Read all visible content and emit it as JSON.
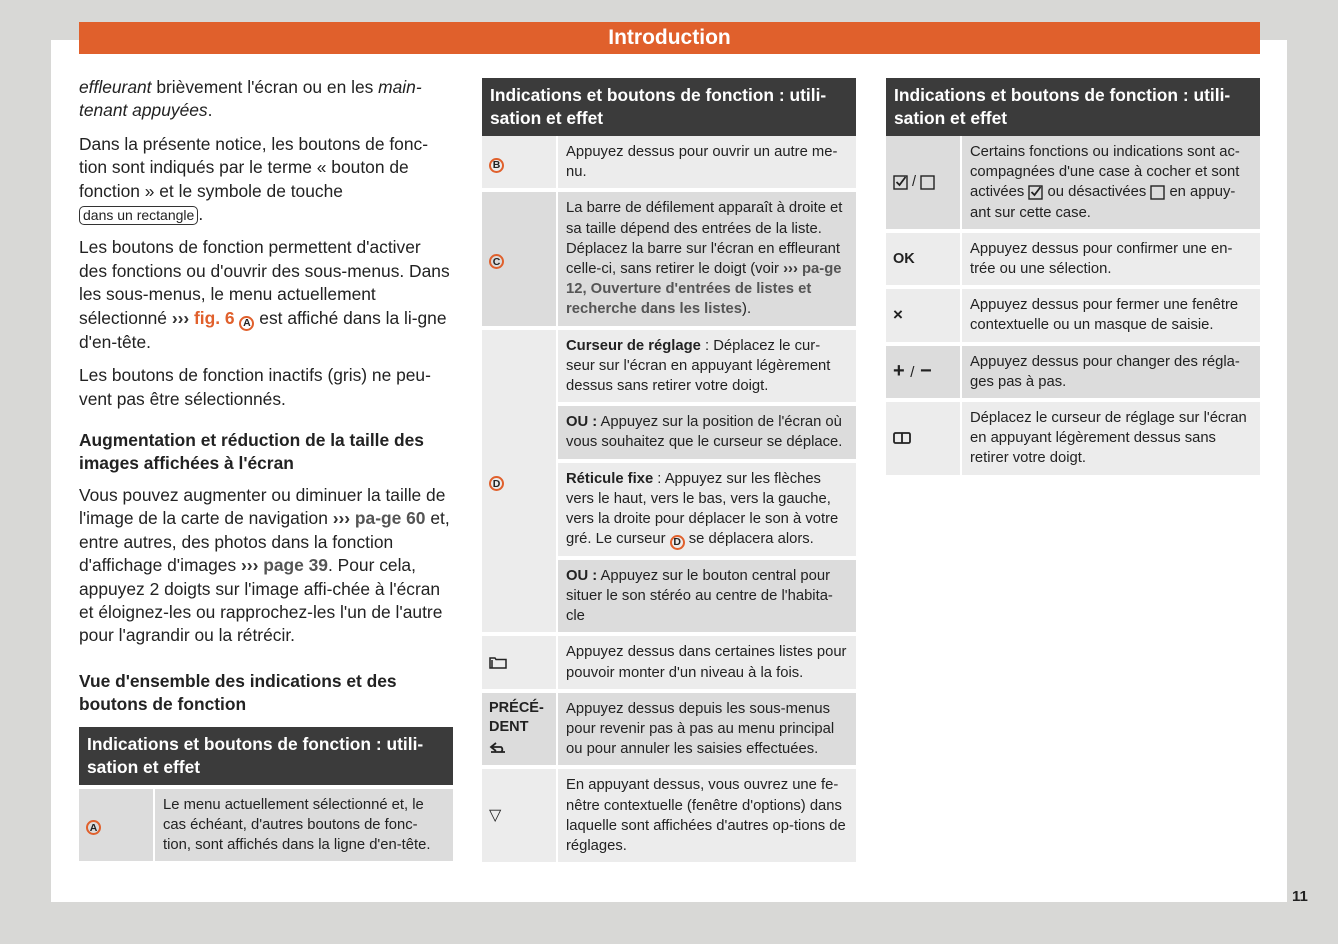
{
  "header": {
    "title": "Introduction",
    "accent_color": "#e0602c"
  },
  "page_number": "11",
  "column1": {
    "para1": {
      "i1": "effleurant",
      "t1": " brièvement l'écran ou en les ",
      "i2": "main-tenant appuyées",
      "t2": "."
    },
    "para2": {
      "text": "Dans la présente notice, les boutons de fonc-tion sont indiqués par le terme « bouton de fonction » et le symbole de touche ",
      "keybox": "dans un rectangle",
      "end": "."
    },
    "para3": {
      "t1": "Les boutons de fonction permettent d'activer des fonctions ou d'ouvrir des sous-menus. Dans les sous-menus, le menu actuellement sélectionné ",
      "chev": "›››",
      "ref": " fig. 6",
      "marker": "A",
      "t2": " est affiché dans la li-gne d'en-tête."
    },
    "para4": "Les boutons de fonction inactifs (gris) ne peu-vent pas être sélectionnés.",
    "heading1": "Augmentation et réduction de la taille des images affichées à l'écran",
    "para5": {
      "t1": "Vous pouvez augmenter ou diminuer la taille de l'image de la carte de navigation ",
      "chev1": "›››",
      "ref1": " pa-ge 60",
      "t2": " et, entre autres, des photos dans la fonction d'affichage d'images ",
      "chev2": "›››",
      "ref2": " page 39",
      "t3": ". Pour cela, appuyez 2 doigts sur l'image affi-chée à l'écran et éloignez-les ou rapprochez-les l'un de l'autre pour l'agrandir ou la rétrécir."
    },
    "heading2": "Vue d'ensemble des indications et des boutons de fonction",
    "table": {
      "title": "Indications et boutons de fonction : utili-sation et effet",
      "rows": [
        {
          "symbol": "A",
          "symbol_type": "circle-letter",
          "desc": "Le menu actuellement sélectionné et, le cas échéant, d'autres boutons de fonc-tion, sont affichés dans la ligne d'en-tête."
        }
      ]
    }
  },
  "column2": {
    "table": {
      "title": "Indications et boutons de fonction : utili-sation et effet",
      "rows": [
        {
          "symbol": "B",
          "symbol_type": "circle-letter",
          "desc": "Appuyez dessus pour ouvrir un autre me-nu."
        },
        {
          "symbol": "C",
          "symbol_type": "circle-letter",
          "desc": "La barre de défilement apparaît à droite et sa taille dépend des entrées de la liste. Déplacez la barre sur l'écran en effleurant celle-ci, sans retirer le doigt (voir ",
          "chev": "›››",
          "ref": " pa-ge 12, Ouverture d'entrées de listes et recherche dans les listes",
          "end": ")."
        },
        {
          "symbol": "D",
          "symbol_type": "circle-letter",
          "subs": [
            {
              "bold": "Curseur de réglage",
              "text": " : Déplacez le cur-seur sur l'écran en appuyant légèrement dessus sans retirer votre doigt."
            },
            {
              "bold": "OU :",
              "text": " Appuyez sur la position de l'écran où vous souhaitez que le curseur se déplace."
            },
            {
              "bold": "Réticule fixe",
              "text": " : Appuyez sur les flèches vers le haut, vers le bas, vers la gauche, vers la droite pour déplacer le son à votre gré. Le curseur ",
              "marker": "D",
              "end": " se déplacera alors."
            },
            {
              "bold": "OU :",
              "text": " Appuyez sur le bouton central pour situer le son stéréo au centre de l'habita-cle"
            }
          ]
        },
        {
          "symbol": "folder-up-icon",
          "symbol_type": "icon",
          "desc": "Appuyez dessus dans certaines listes pour pouvoir monter d'un niveau à la fois."
        },
        {
          "symbol": "PRÉCÉ-DENT",
          "symbol_type": "text-icon",
          "icon": "back-arrow-icon",
          "desc": "Appuyez dessus depuis les sous-menus pour revenir pas à pas au menu principal ou pour annuler les saisies effectuées."
        },
        {
          "symbol": "▽",
          "symbol_type": "glyph",
          "desc": "En appuyant dessus, vous ouvrez une fe-nêtre contextuelle (fenêtre d'options) dans laquelle sont affichées d'autres op-tions de réglages."
        }
      ]
    }
  },
  "column3": {
    "table": {
      "title": "Indications et boutons de fonction : utili-sation et effet",
      "rows": [
        {
          "symbol": "checkbox-checked / checkbox-empty",
          "symbol_type": "icons",
          "sep": "/",
          "desc1": "Certains fonctions ou indications sont ac-compagnées d'une case à cocher et sont activées ",
          "desc2": " ou désactivées ",
          "desc3": " en appuy-ant sur cette case."
        },
        {
          "symbol": "OK",
          "symbol_type": "text",
          "desc": "Appuyez dessus pour confirmer une en-trée ou une sélection."
        },
        {
          "symbol": "×",
          "symbol_type": "glyph",
          "desc": "Appuyez dessus pour fermer une fenêtre contextuelle ou un masque de saisie."
        },
        {
          "symbol": "+ / −",
          "symbol_type": "glyph",
          "plus": "+",
          "sep": "/",
          "minus": "−",
          "desc": "Appuyez dessus pour changer des régla-ges pas à pas."
        },
        {
          "symbol": "slider-cursor-icon",
          "symbol_type": "icon",
          "desc": "Déplacez le curseur de réglage sur l'écran en appuyant légèrement dessus sans retirer votre doigt."
        }
      ]
    }
  }
}
